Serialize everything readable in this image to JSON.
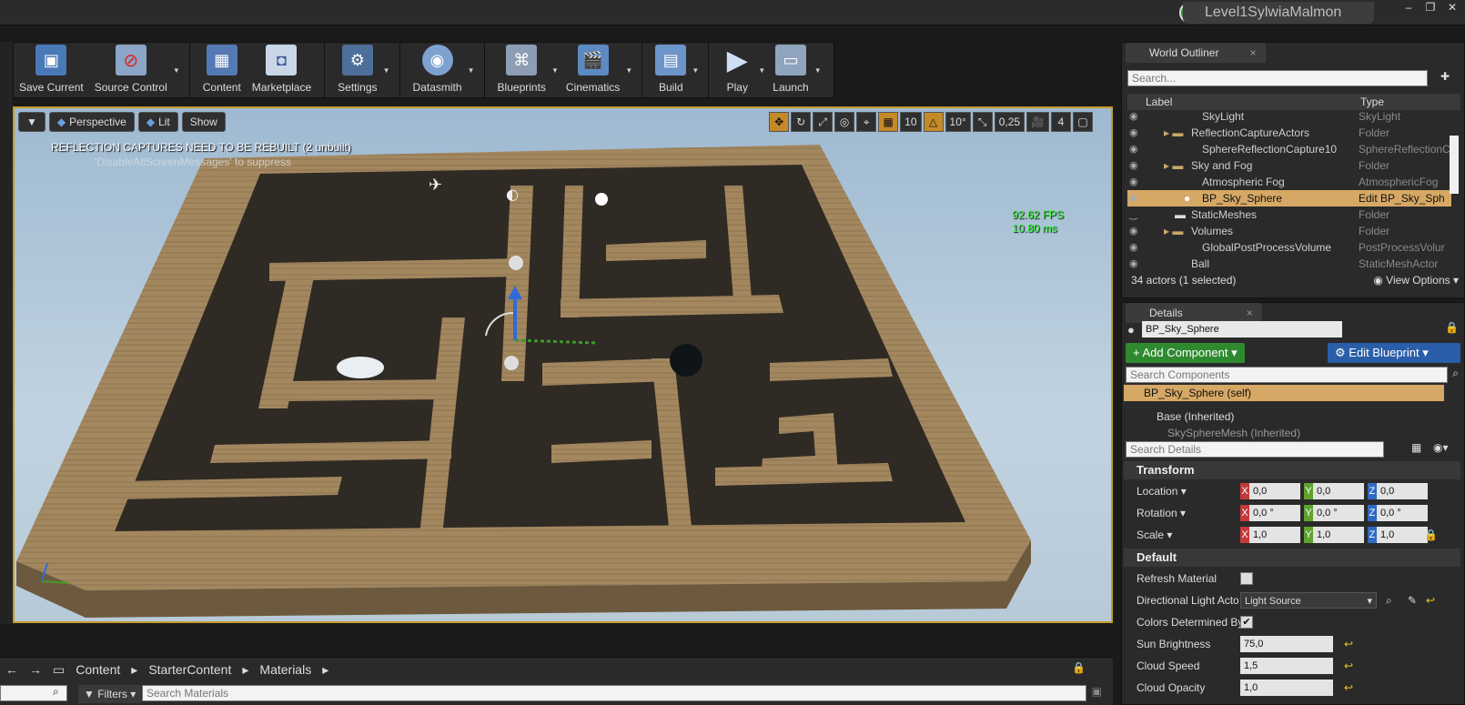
{
  "window": {
    "project_name": "Level1SylwiaMalmon"
  },
  "toolbar": {
    "items": [
      {
        "label": "Save Current",
        "icon": "floppy-icon"
      },
      {
        "label": "Source Control",
        "icon": "source-control-icon"
      },
      {
        "label": "Content",
        "icon": "content-grid-icon"
      },
      {
        "label": "Marketplace",
        "icon": "marketplace-bag-icon"
      },
      {
        "label": "Settings",
        "icon": "gears-icon"
      },
      {
        "label": "Datasmith",
        "icon": "datasmith-icon"
      },
      {
        "label": "Blueprints",
        "icon": "blueprint-controller-icon"
      },
      {
        "label": "Cinematics",
        "icon": "clapper-icon"
      },
      {
        "label": "Build",
        "icon": "build-cubes-icon"
      },
      {
        "label": "Play",
        "icon": "play-triangle-icon"
      },
      {
        "label": "Launch",
        "icon": "launch-monitor-icon"
      }
    ]
  },
  "viewport": {
    "perspective": "Perspective",
    "lit": "Lit",
    "show": "Show",
    "grid_snap": "10",
    "rot_snap": "10°",
    "scale_snap": "0,25",
    "cam_speed": "4",
    "message": "REFLECTION CAPTURES NEED TO BE REBUILT (2 unbuilt)",
    "message2": "'DisableAllScreenMessages' to suppress",
    "fps": "92.62 FPS",
    "ms": "10.80 ms"
  },
  "outliner": {
    "tab": "World Outliner",
    "search_placeholder": "Search...",
    "col_label": "Label",
    "col_type": "Type",
    "rows": [
      {
        "label": "SkyLight",
        "type": "SkyLight",
        "indent": 3
      },
      {
        "label": "ReflectionCaptureActors",
        "type": "Folder",
        "indent": 2
      },
      {
        "label": "SphereReflectionCapture10",
        "type": "SphereReflectionC",
        "indent": 3
      },
      {
        "label": "Sky and Fog",
        "type": "Folder",
        "indent": 2
      },
      {
        "label": "Atmospheric Fog",
        "type": "AtmosphericFog",
        "indent": 3
      },
      {
        "label": "BP_Sky_Sphere",
        "type": "Edit BP_Sky_Sph",
        "indent": 3,
        "selected": true
      },
      {
        "label": "StaticMeshes",
        "type": "Folder",
        "indent": 2
      },
      {
        "label": "Volumes",
        "type": "Folder",
        "indent": 2
      },
      {
        "label": "GlobalPostProcessVolume",
        "type": "PostProcessVolur",
        "indent": 3
      },
      {
        "label": "Ball",
        "type": "StaticMeshActor",
        "indent": 2
      }
    ],
    "footer_count": "34 actors (1 selected)",
    "view_options": "View Options"
  },
  "details": {
    "tab": "Details",
    "name": "BP_Sky_Sphere",
    "add_component": "+ Add Component",
    "edit_blueprint": "Edit Blueprint",
    "search_components": "Search Components",
    "comp_self": "BP_Sky_Sphere (self)",
    "comp_base": "Base (Inherited)",
    "comp_mesh": "SkySphereMesh (Inherited)",
    "search_details": "Search Details",
    "transform": "Transform",
    "location": {
      "label": "Location",
      "x": "0,0",
      "y": "0,0",
      "z": "0,0"
    },
    "rotation": {
      "label": "Rotation",
      "x": "0,0 °",
      "y": "0,0 °",
      "z": "0,0 °"
    },
    "scale": {
      "label": "Scale",
      "x": "1,0",
      "y": "1,0",
      "z": "1,0"
    },
    "default": "Default",
    "refresh_material": "Refresh Material",
    "directional_light": "Directional Light Actor",
    "directional_light_value": "Light Source",
    "colors_determined": "Colors Determined By",
    "sun_brightness": {
      "label": "Sun Brightness",
      "value": "75,0"
    },
    "cloud_speed": {
      "label": "Cloud Speed",
      "value": "1,5"
    },
    "cloud_opacity": {
      "label": "Cloud Opacity",
      "value": "1,0"
    }
  },
  "content_browser": {
    "crumbs": [
      "Content",
      "StarterContent",
      "Materials"
    ],
    "filters": "Filters",
    "search_placeholder": "Search Materials"
  }
}
